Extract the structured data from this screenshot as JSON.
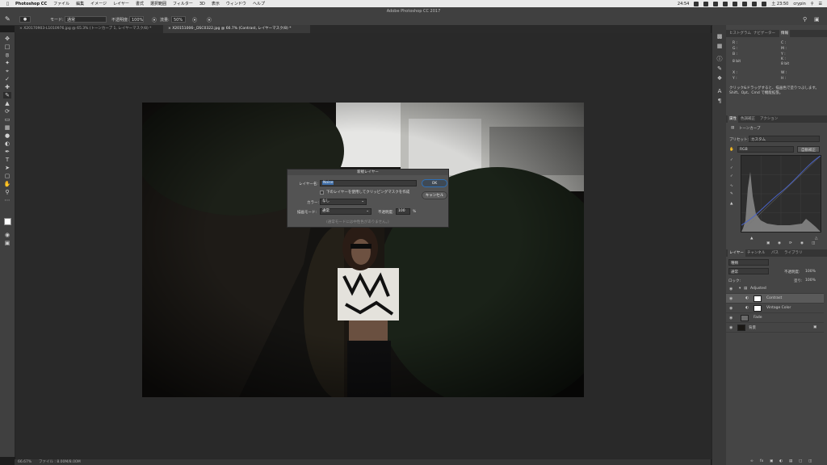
{
  "menubar": {
    "app_name": "Photoshop CC",
    "items": [
      "ファイル",
      "編集",
      "イメージ",
      "レイヤー",
      "書式",
      "選択範囲",
      "フィルター",
      "3D",
      "表示",
      "ウィンドウ",
      "ヘルプ"
    ],
    "clock": "24:54",
    "time": "土 23:50",
    "user": "crypin"
  },
  "window": {
    "title": "Adobe Photoshop CC 2017"
  },
  "options_bar": {
    "mode_label": "モード:",
    "mode_value": "通常",
    "opacity_label": "不透明度:",
    "opacity_value": "100%",
    "flow_label": "流量:",
    "flow_value": "50%"
  },
  "tabs": [
    {
      "label": "X20170903-L1010976.jpg @ 65.3% (トーンカーブ 1, レイヤーマスク/8) *",
      "active": false
    },
    {
      "label": "X20151006-_DSC0322.jpg @ 66.7% (Contrast, レイヤーマスク/8) *",
      "active": true
    }
  ],
  "dialog": {
    "title": "新規レイヤー",
    "name_label": "レイヤー名:",
    "name_value": "Noise",
    "clip_label": "下のレイヤーを使用してクリッピングマスクを作成",
    "color_label": "カラー:",
    "color_value": "なし",
    "mode_label": "描画モード:",
    "mode_value": "通常",
    "opacity_label": "不透明度:",
    "opacity_value": "100",
    "opacity_unit": "%",
    "note": "(通常モードには中性色がありません。)",
    "ok_label": "OK",
    "cancel_label": "キャンセル"
  },
  "status_bar": {
    "zoom": "66.67%",
    "file_info": "ファイル : 8.00M/8.00M"
  },
  "history_panel": {
    "tabs": [
      "ヒストグラム",
      "ナビゲーター",
      "情報"
    ],
    "active_tab": 2,
    "info_rows": [
      "R :",
      "G :",
      "B :",
      "8 bit",
      "C :",
      "M :",
      "Y :",
      "K :",
      "8 bit",
      "X :",
      "Y :",
      "W :",
      "H :"
    ],
    "hint": "クリック&ドラッグすると、描画色で塗りつぶします。Shift、Opt、Cmd で機能拡張。"
  },
  "properties_panel": {
    "tabs": [
      "属性",
      "色調補正",
      "アクション"
    ],
    "active_tab": 0,
    "type_label": "トーンカーブ",
    "preset_label": "プリセット:",
    "preset_value": "カスタム",
    "channel_value": "RGB",
    "auto_label": "自動補正"
  },
  "layers_panel": {
    "tabs": [
      "レイヤー",
      "チャンネル",
      "パス",
      "ライブラリ"
    ],
    "active_tab": 0,
    "filter_value": "種類",
    "blend_value": "通常",
    "opacity_label": "不透明度:",
    "opacity_value": "100%",
    "lock_label": "ロック:",
    "fill_label": "塗り:",
    "fill_value": "100%",
    "layers": [
      {
        "name": "Adjusted",
        "kind": "group",
        "selected": false
      },
      {
        "name": "Contrast",
        "kind": "adjustment",
        "selected": true
      },
      {
        "name": "Vintage Color",
        "kind": "adjustment",
        "selected": false
      },
      {
        "name": "Fade",
        "kind": "fill",
        "selected": false
      },
      {
        "name": "背景",
        "kind": "image",
        "selected": false
      }
    ]
  },
  "colors": {
    "menubar_bg": "#e9e9e9",
    "chrome_bg": "#404040",
    "canvas_bg": "#292929",
    "dialog_bg": "#535353",
    "ok_button": "#2f6fb5",
    "selection": "#5a5a5a"
  }
}
